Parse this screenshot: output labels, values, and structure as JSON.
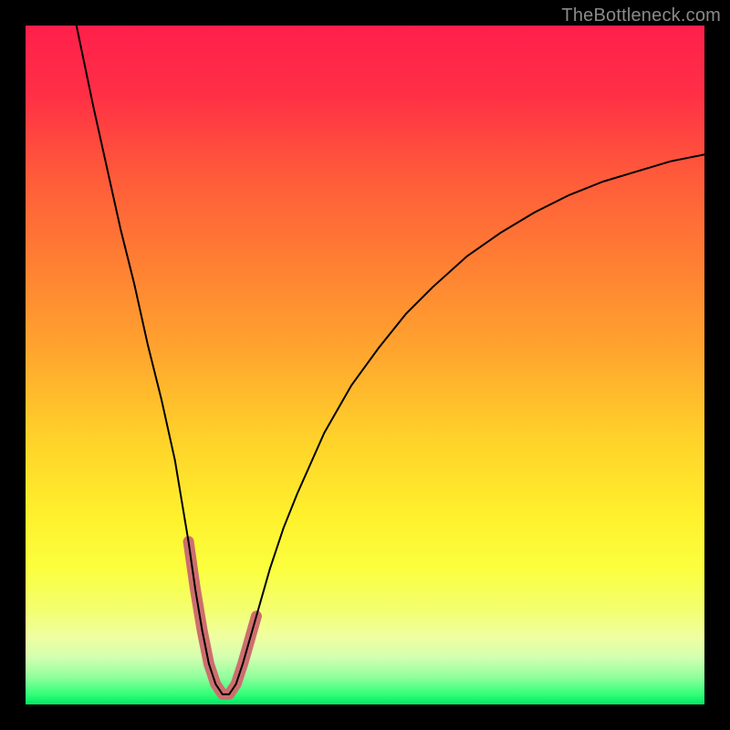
{
  "watermark": "TheBottleneck.com",
  "chart_data": {
    "type": "line",
    "title": "",
    "xlabel": "",
    "ylabel": "",
    "xlim": [
      0,
      100
    ],
    "ylim": [
      0,
      100
    ],
    "grid": false,
    "legend": false,
    "annotations": [],
    "series": [
      {
        "name": "bottleneck-curve",
        "color": "#000000",
        "stroke_width_px": 2,
        "x": [
          7.5,
          10,
          12,
          14,
          16,
          18,
          20,
          22,
          24,
          25,
          26,
          27,
          28,
          29,
          30,
          31,
          32,
          34,
          36,
          38,
          40,
          44,
          48,
          52,
          56,
          60,
          65,
          70,
          75,
          80,
          85,
          90,
          95,
          100
        ],
        "y": [
          100,
          88,
          79,
          70,
          62,
          53,
          45,
          36,
          24,
          17,
          11,
          6,
          3,
          1.5,
          1.5,
          3,
          6,
          13,
          20,
          26,
          31,
          40,
          47,
          52.5,
          57.5,
          61.5,
          66,
          69.5,
          72.5,
          75,
          77,
          78.5,
          80,
          81
        ]
      },
      {
        "name": "sweet-spot-highlight",
        "color": "#cd6e6e",
        "stroke_width_px": 12,
        "x": [
          24,
          25,
          26,
          27,
          28,
          29,
          30,
          31,
          32,
          33,
          34
        ],
        "y": [
          24,
          17,
          11,
          6,
          3,
          1.5,
          1.5,
          3,
          6,
          9.5,
          13
        ]
      }
    ],
    "background": {
      "type": "vertical-gradient",
      "stops": [
        {
          "pos": 0.0,
          "color": "#ff1f4b"
        },
        {
          "pos": 0.1,
          "color": "#ff2f46"
        },
        {
          "pos": 0.22,
          "color": "#ff5a3a"
        },
        {
          "pos": 0.35,
          "color": "#ff7f33"
        },
        {
          "pos": 0.48,
          "color": "#ffa52e"
        },
        {
          "pos": 0.6,
          "color": "#ffcf2a"
        },
        {
          "pos": 0.72,
          "color": "#fff02c"
        },
        {
          "pos": 0.8,
          "color": "#fbff3e"
        },
        {
          "pos": 0.86,
          "color": "#f3ff6f"
        },
        {
          "pos": 0.9,
          "color": "#efffa0"
        },
        {
          "pos": 0.93,
          "color": "#d4ffb0"
        },
        {
          "pos": 0.96,
          "color": "#8fff9c"
        },
        {
          "pos": 0.985,
          "color": "#33ff77"
        },
        {
          "pos": 1.0,
          "color": "#00e865"
        }
      ]
    }
  }
}
